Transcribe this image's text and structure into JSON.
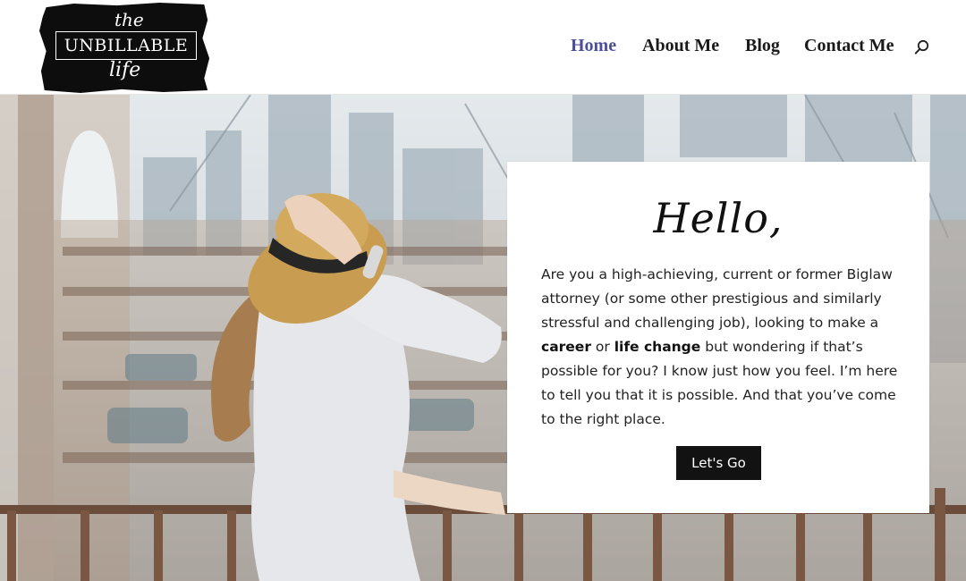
{
  "logo": {
    "line1": "the",
    "line2": "UNBILLABLE",
    "line3": "life"
  },
  "nav": {
    "items": [
      {
        "label": "Home",
        "active": true
      },
      {
        "label": "About Me",
        "active": false
      },
      {
        "label": "Blog",
        "active": false
      },
      {
        "label": "Contact Me",
        "active": false
      }
    ],
    "search_icon": "search-icon"
  },
  "colors": {
    "nav_active": "#4b4f9a",
    "nav_text": "#1a1a1a",
    "button_bg": "#121212",
    "card_bg": "#ffffff"
  },
  "hero": {
    "greeting": "Hello,",
    "intro_part1": "Are you a high-achieving, current or former Biglaw attorney (or some other prestigious and similarly stressful and challenging job), looking to make a ",
    "intro_bold1": "career",
    "intro_part2": " or ",
    "intro_bold2": "life change",
    "intro_part3": " but wondering if that’s possible for you? I know just how you feel. I’m here to tell you that it is possible. And that you’ve come to the right place.",
    "cta_label": "Let's Go"
  }
}
